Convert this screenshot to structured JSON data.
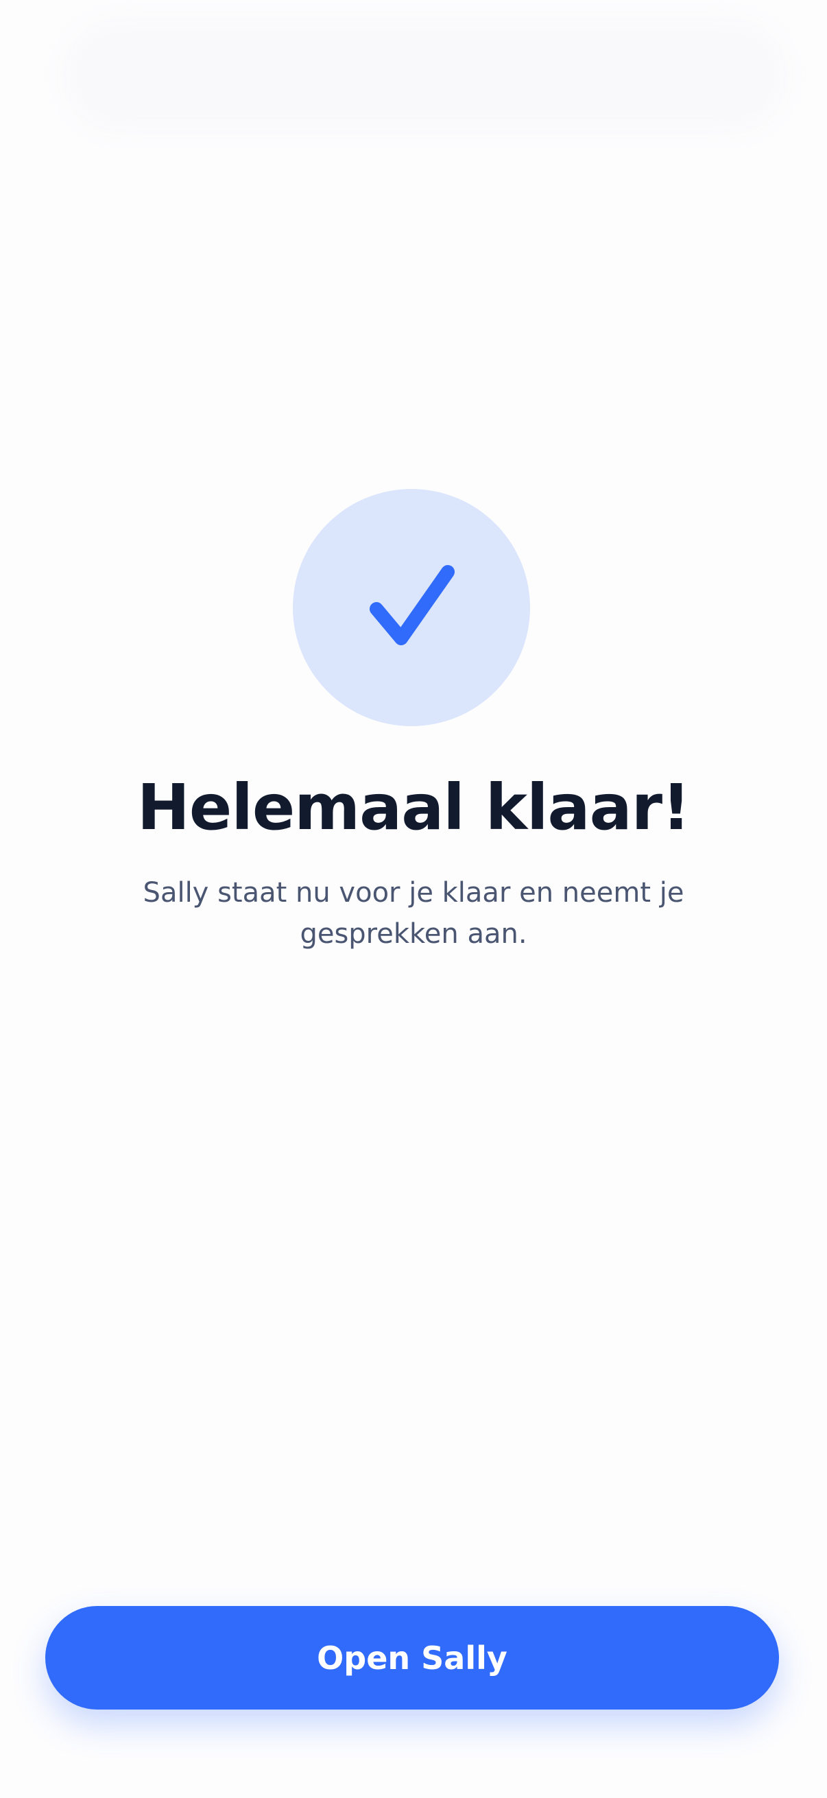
{
  "success": {
    "icon": "checkmark-icon",
    "title": "Helemaal klaar!",
    "subtitle": "Sally staat nu voor je klaar en neemt je gesprekken aan."
  },
  "cta": {
    "label": "Open Sally"
  },
  "colors": {
    "accent": "#306bfc",
    "icon_bg": "#dbe5fc",
    "title": "#121a2e",
    "subtitle": "#4a5671",
    "background": "#fdfdfe"
  }
}
